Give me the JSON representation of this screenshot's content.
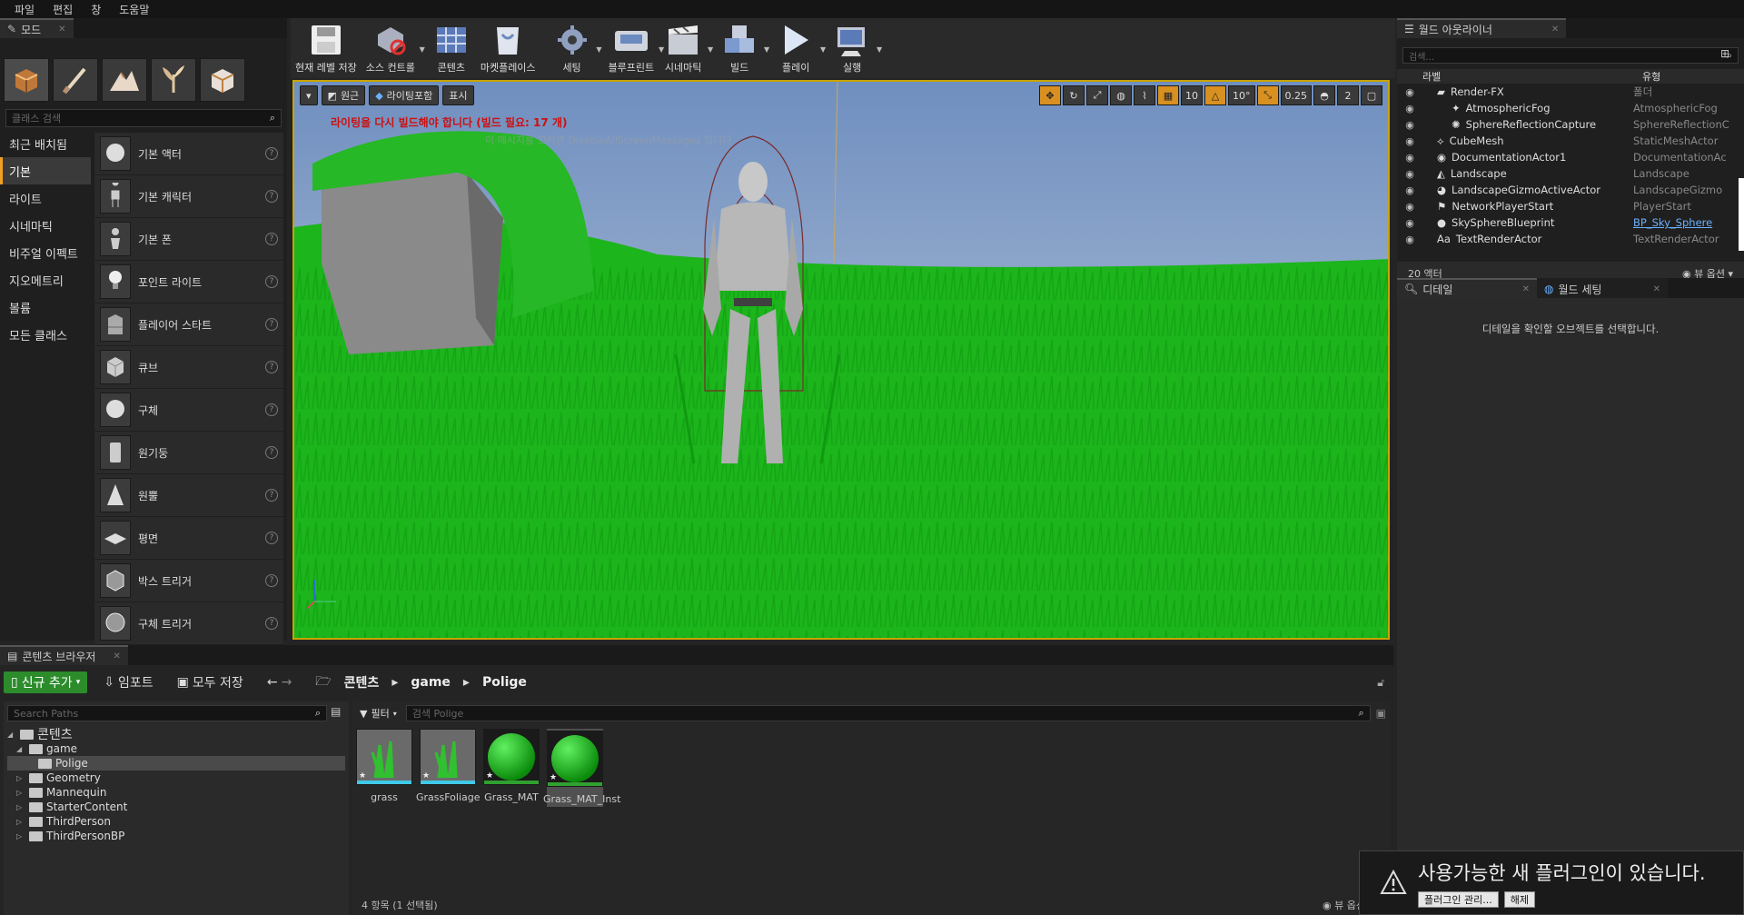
{
  "menu": [
    "파일",
    "편집",
    "창",
    "도움말"
  ],
  "modes": {
    "tab_label": "모드",
    "search_placeholder": "클래스 검색",
    "categories": [
      "최근 배치됨",
      "기본",
      "라이트",
      "시네마틱",
      "비주얼 이펙트",
      "지오메트리",
      "볼륨",
      "모든 클래스"
    ],
    "selected_category": "기본",
    "items": [
      "기본 액터",
      "기본 캐릭터",
      "기본 폰",
      "포인트 라이트",
      "플레이어 스타트",
      "큐브",
      "구체",
      "원기둥",
      "원뿔",
      "평면",
      "박스 트리거",
      "구체 트리거"
    ]
  },
  "toolbar": {
    "buttons": [
      {
        "label": "현재 레벨 저장",
        "icon": "save-icon",
        "dropdown": false
      },
      {
        "label": "소스 컨트롤",
        "icon": "source-control-icon",
        "dropdown": true
      },
      {
        "label": "콘텐츠",
        "icon": "content-icon",
        "dropdown": false
      },
      {
        "label": "마켓플레이스",
        "icon": "marketplace-icon",
        "dropdown": false
      },
      {
        "label": "세팅",
        "icon": "settings-icon",
        "dropdown": true
      },
      {
        "label": "블루프린트",
        "icon": "blueprint-icon",
        "dropdown": true
      },
      {
        "label": "시네마틱",
        "icon": "cinematic-icon",
        "dropdown": true
      },
      {
        "label": "빌드",
        "icon": "build-icon",
        "dropdown": true
      },
      {
        "label": "플레이",
        "icon": "play-icon",
        "dropdown": true
      },
      {
        "label": "실행",
        "icon": "launch-icon",
        "dropdown": true
      }
    ]
  },
  "viewport": {
    "perspective_label": "원근",
    "lighting_label": "라이팅포함",
    "show_label": "표시",
    "grid_snap": "10",
    "rot_snap": "10°",
    "scale_snap": "0.25",
    "cam_speed": "2",
    "warning": "라이팅을 다시 빌드해야 합니다 (빌드 필요: 17 개)",
    "faint_msg": "이 메시지를 끄려면 DisableAllScreenMessages 입니다"
  },
  "outliner": {
    "tab_label": "월드 아웃라이너",
    "search_placeholder": "검색...",
    "col_label": "라벨",
    "col_type": "유형",
    "rows": [
      {
        "name": "Render-FX",
        "type": "폴더",
        "indent": 1,
        "link": false
      },
      {
        "name": "AtmosphericFog",
        "type": "AtmosphericFog",
        "indent": 2,
        "link": false
      },
      {
        "name": "SphereReflectionCapture",
        "type": "SphereReflectionC",
        "indent": 2,
        "link": false
      },
      {
        "name": "CubeMesh",
        "type": "StaticMeshActor",
        "indent": 1,
        "link": false
      },
      {
        "name": "DocumentationActor1",
        "type": "DocumentationAc",
        "indent": 1,
        "link": false
      },
      {
        "name": "Landscape",
        "type": "Landscape",
        "indent": 1,
        "link": false
      },
      {
        "name": "LandscapeGizmoActiveActor",
        "type": "LandscapeGizmo",
        "indent": 1,
        "link": false
      },
      {
        "name": "NetworkPlayerStart",
        "type": "PlayerStart",
        "indent": 1,
        "link": false
      },
      {
        "name": "SkySphereBlueprint",
        "type": "BP_Sky_Sphere",
        "indent": 1,
        "link": true
      },
      {
        "name": "TextRenderActor",
        "type": "TextRenderActor",
        "indent": 1,
        "link": false
      }
    ],
    "actor_count": "20 액터",
    "view_options": "뷰 옵션"
  },
  "details": {
    "tab_details": "디테일",
    "tab_world": "월드 세팅",
    "empty_msg": "디테일을 확인할 오브젝트를 선택합니다."
  },
  "content_browser": {
    "tab_label": "콘텐츠 브라우저",
    "add_new": "신규 추가",
    "import": "임포트",
    "save_all": "모두 저장",
    "breadcrumb": [
      "콘텐츠",
      "game",
      "Polige"
    ],
    "path_search_placeholder": "Search Paths",
    "filter_label": "필터",
    "asset_search_placeholder": "검색 Polige",
    "tree": [
      {
        "name": "콘텐츠",
        "depth": 0,
        "expanded": true,
        "selected": false
      },
      {
        "name": "game",
        "depth": 1,
        "expanded": true,
        "selected": false
      },
      {
        "name": "Polige",
        "depth": 2,
        "expanded": false,
        "selected": true
      },
      {
        "name": "Geometry",
        "depth": 1,
        "expanded": false,
        "selected": false
      },
      {
        "name": "Mannequin",
        "depth": 1,
        "expanded": false,
        "selected": false
      },
      {
        "name": "StarterContent",
        "depth": 1,
        "expanded": false,
        "selected": false
      },
      {
        "name": "ThirdPerson",
        "depth": 1,
        "expanded": false,
        "selected": false
      },
      {
        "name": "ThirdPersonBP",
        "depth": 1,
        "expanded": false,
        "selected": false
      }
    ],
    "assets": [
      {
        "name": "grass",
        "kind": "foliage",
        "selected": false
      },
      {
        "name": "GrassFoliage",
        "kind": "foliage",
        "selected": false
      },
      {
        "name": "Grass_MAT",
        "kind": "material",
        "selected": false
      },
      {
        "name": "Grass_MAT_Inst",
        "kind": "material",
        "selected": true
      }
    ],
    "status": "4 항목 (1 선택됨)",
    "view_options": "뷰 옵션"
  },
  "notification": {
    "title": "사용가능한 새 플러그인이 있습니다.",
    "manage": "플러그인 관리...",
    "dismiss": "해제"
  },
  "colors": {
    "accent": "#c9a400",
    "grass": "#1cb51c",
    "add_new": "#2c8c2c"
  }
}
